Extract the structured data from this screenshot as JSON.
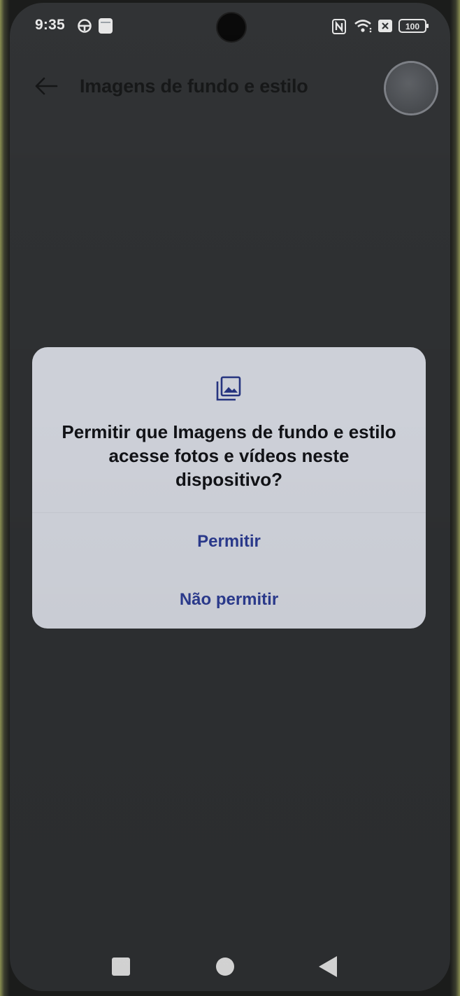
{
  "status_bar": {
    "time": "9:35",
    "battery_level": "100",
    "icons": [
      "steering-wheel-icon",
      "notification-app-icon",
      "nfc-icon",
      "wifi-icon",
      "sim-off-icon",
      "battery-icon"
    ]
  },
  "app_bar": {
    "title": "Imagens de fundo e estilo",
    "back_icon": "back-arrow-icon"
  },
  "dialog": {
    "icon": "photo-library-icon",
    "title": "Permitir que Imagens de fundo e estilo acesse fotos e vídeos neste dispositivo?",
    "allow_label": "Permitir",
    "deny_label": "Não permitir",
    "accent_color": "#2b3a8c"
  },
  "nav_bar": {
    "buttons": [
      "recents-square-icon",
      "home-circle-icon",
      "back-triangle-icon"
    ]
  }
}
